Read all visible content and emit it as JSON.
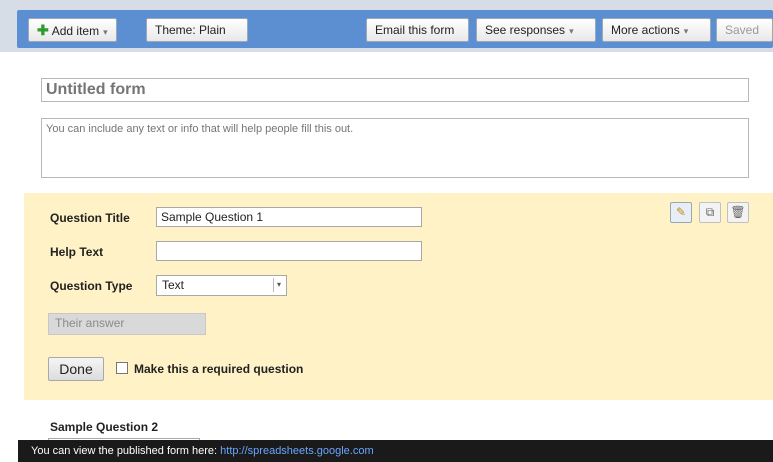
{
  "toolbar": {
    "add_item": "Add item",
    "theme": "Theme:  Plain",
    "email_form": "Email this form",
    "see_responses": "See responses",
    "more_actions": "More actions",
    "saved": "Saved"
  },
  "form": {
    "title_placeholder": "Untitled form",
    "description_placeholder": "You can include any text or info that will help people fill this out."
  },
  "question_edit": {
    "title_label": "Question Title",
    "title_value": "Sample Question 1",
    "help_label": "Help Text",
    "help_value": "",
    "type_label": "Question Type",
    "type_value": "Text",
    "preview_placeholder": "Their answer",
    "done_label": "Done",
    "required_label": "Make this a required question"
  },
  "question2": {
    "title": "Sample Question 2"
  },
  "footer": {
    "text": "You can view the published form here: ",
    "link": "http://spreadsheets.google.com"
  },
  "colors": {
    "toolbar_blue": "#5b8fd1",
    "edit_panel": "#fff2c7",
    "footer_bg": "#1a1a1a"
  },
  "icons": [
    "plus-icon",
    "pencil-icon",
    "duplicate-icon",
    "trash-icon",
    "dropdown-arrow-icon"
  ]
}
